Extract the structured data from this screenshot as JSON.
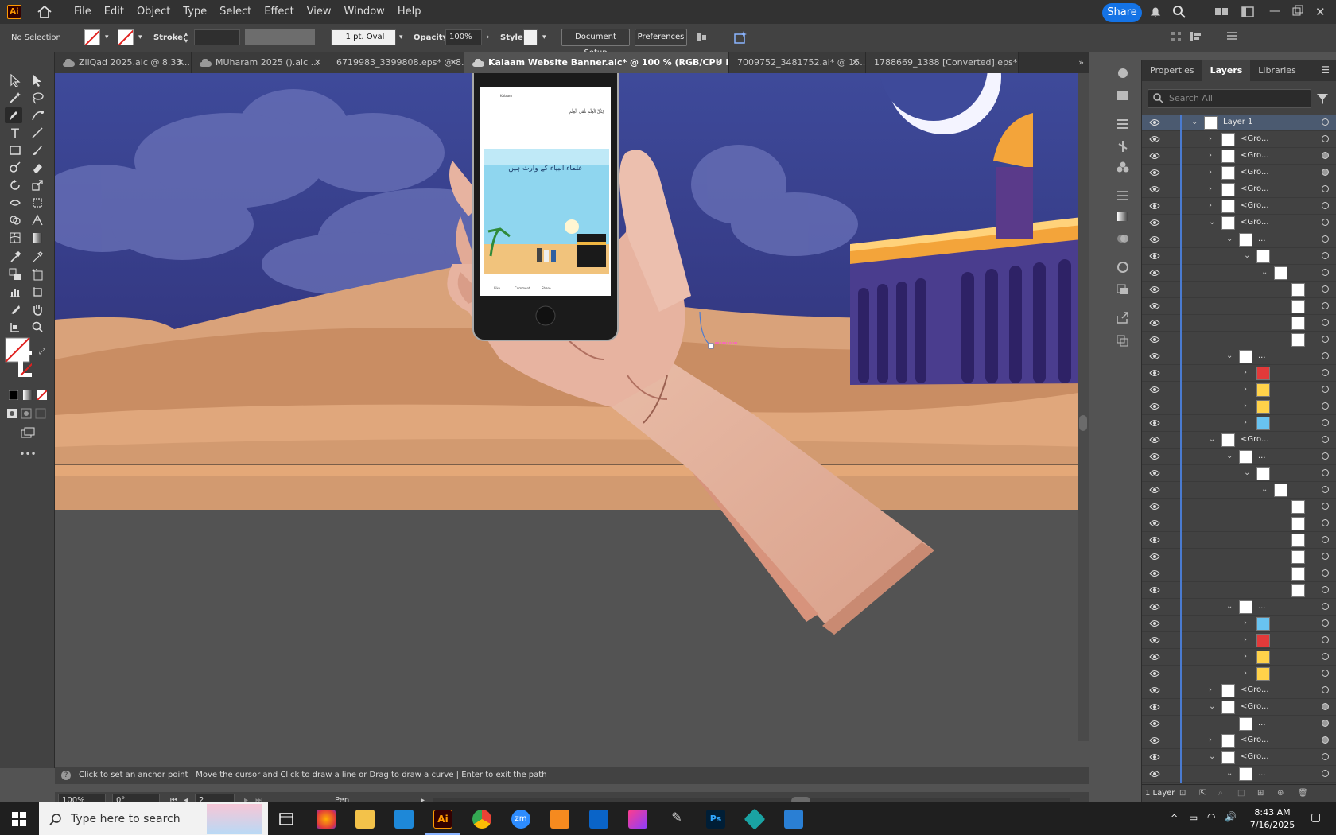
{
  "menubar": {
    "logo": "Ai",
    "items": [
      "File",
      "Edit",
      "Object",
      "Type",
      "Select",
      "Effect",
      "View",
      "Window",
      "Help"
    ],
    "share_label": "Share"
  },
  "control": {
    "selection": "No Selection",
    "stroke_label": "Stroke:",
    "brush": "1 pt. Oval",
    "opacity_label": "Opacity:",
    "opacity": "100%",
    "style_label": "Style:",
    "document_setup": "Document Setup",
    "preferences": "Preferences"
  },
  "tabs": [
    {
      "label": "ZilQad 2025.aic @ 8.33..."
    },
    {
      "label": "MUharam 2025 ().aic ..."
    },
    {
      "label": "6719983_3399808.eps* @ 8..."
    },
    {
      "label": "Kalaam Website Banner.aic* @ 100 % (RGB/CPU Preview)"
    },
    {
      "label": "7009752_3481752.ai* @ 15..."
    },
    {
      "label": "1788669_1388 [Converted].eps*"
    }
  ],
  "panel": {
    "tabs": [
      "Properties",
      "Layers",
      "Libraries"
    ],
    "search_placeholder": "Search All",
    "layer_count": "1 Layer"
  },
  "layers": [
    {
      "name": "Layer 1",
      "indent": 0,
      "chev": "v",
      "sel": true,
      "target": "o"
    },
    {
      "name": "<Gro...",
      "indent": 1,
      "chev": ">",
      "target": "o"
    },
    {
      "name": "<Gro...",
      "indent": 1,
      "chev": ">",
      "target": "f"
    },
    {
      "name": "<Gro...",
      "indent": 1,
      "chev": ">",
      "target": "f"
    },
    {
      "name": "<Gro...",
      "indent": 1,
      "chev": ">",
      "target": "o"
    },
    {
      "name": "<Gro...",
      "indent": 1,
      "chev": ">",
      "target": "o"
    },
    {
      "name": "<Gro...",
      "indent": 1,
      "chev": "v",
      "target": "o"
    },
    {
      "name": "...",
      "indent": 2,
      "chev": "v",
      "target": "o"
    },
    {
      "name": "",
      "indent": 3,
      "chev": "v",
      "target": "o"
    },
    {
      "name": "",
      "indent": 4,
      "chev": "v",
      "target": "o"
    },
    {
      "name": "",
      "indent": 5,
      "chev": "",
      "target": "o"
    },
    {
      "name": "",
      "indent": 5,
      "chev": "",
      "target": "o"
    },
    {
      "name": "",
      "indent": 5,
      "chev": "",
      "target": "o"
    },
    {
      "name": "",
      "indent": 5,
      "chev": "",
      "target": "o"
    },
    {
      "name": "...",
      "indent": 2,
      "chev": "v",
      "target": "o"
    },
    {
      "name": "",
      "indent": 3,
      "chev": ">",
      "target": "o"
    },
    {
      "name": "",
      "indent": 3,
      "chev": ">",
      "target": "o"
    },
    {
      "name": "",
      "indent": 3,
      "chev": ">",
      "target": "o"
    },
    {
      "name": "",
      "indent": 3,
      "chev": ">",
      "target": "o"
    },
    {
      "name": "<Gro...",
      "indent": 1,
      "chev": "v",
      "target": "o"
    },
    {
      "name": "...",
      "indent": 2,
      "chev": "v",
      "target": "o"
    },
    {
      "name": "",
      "indent": 3,
      "chev": "v",
      "target": "o"
    },
    {
      "name": "",
      "indent": 4,
      "chev": "v",
      "target": "o"
    },
    {
      "name": "",
      "indent": 5,
      "chev": "",
      "target": "o"
    },
    {
      "name": "",
      "indent": 5,
      "chev": "",
      "target": "o"
    },
    {
      "name": "",
      "indent": 5,
      "chev": "",
      "target": "o"
    },
    {
      "name": "",
      "indent": 5,
      "chev": "",
      "target": "o"
    },
    {
      "name": "",
      "indent": 5,
      "chev": "",
      "target": "o"
    },
    {
      "name": "",
      "indent": 5,
      "chev": "",
      "target": "o"
    },
    {
      "name": "...",
      "indent": 2,
      "chev": "v",
      "target": "o"
    },
    {
      "name": "",
      "indent": 3,
      "chev": ">",
      "target": "o"
    },
    {
      "name": "",
      "indent": 3,
      "chev": ">",
      "target": "o"
    },
    {
      "name": "",
      "indent": 3,
      "chev": ">",
      "target": "o"
    },
    {
      "name": "",
      "indent": 3,
      "chev": ">",
      "target": "o"
    },
    {
      "name": "<Gro...",
      "indent": 1,
      "chev": ">",
      "target": "o"
    },
    {
      "name": "<Gro...",
      "indent": 1,
      "chev": "v",
      "target": "f"
    },
    {
      "name": "...",
      "indent": 2,
      "chev": "",
      "target": "f"
    },
    {
      "name": "<Gro...",
      "indent": 1,
      "chev": ">",
      "target": "f"
    },
    {
      "name": "<Gro...",
      "indent": 1,
      "chev": "v",
      "target": "o"
    },
    {
      "name": "...",
      "indent": 2,
      "chev": "v",
      "target": "o"
    }
  ],
  "hint": "Click to set an anchor point  |  Move the cursor and Click to draw a line or Drag to draw a curve  |  Enter to exit the path",
  "status": {
    "zoom": "100%",
    "rotation": "0°",
    "artboard": "2",
    "tool": "Pen"
  },
  "phone": {
    "account": "Kalaam",
    "post_line": "لِكُلِّ اَلْعِلْمِ تَلْقَى الْعِلْمَ",
    "heading": "علماء انبیاء کے وارث ہیں",
    "like": "Like",
    "comment": "Comment",
    "share": "Share"
  },
  "taskbar": {
    "search_placeholder": "Type here to search",
    "time": "8:43 AM",
    "date": "7/16/2025"
  },
  "colors": {
    "share": "#1473e6",
    "accent": "#ff9a00",
    "sky": "#3d3f8e",
    "sand": "#e8a878"
  }
}
